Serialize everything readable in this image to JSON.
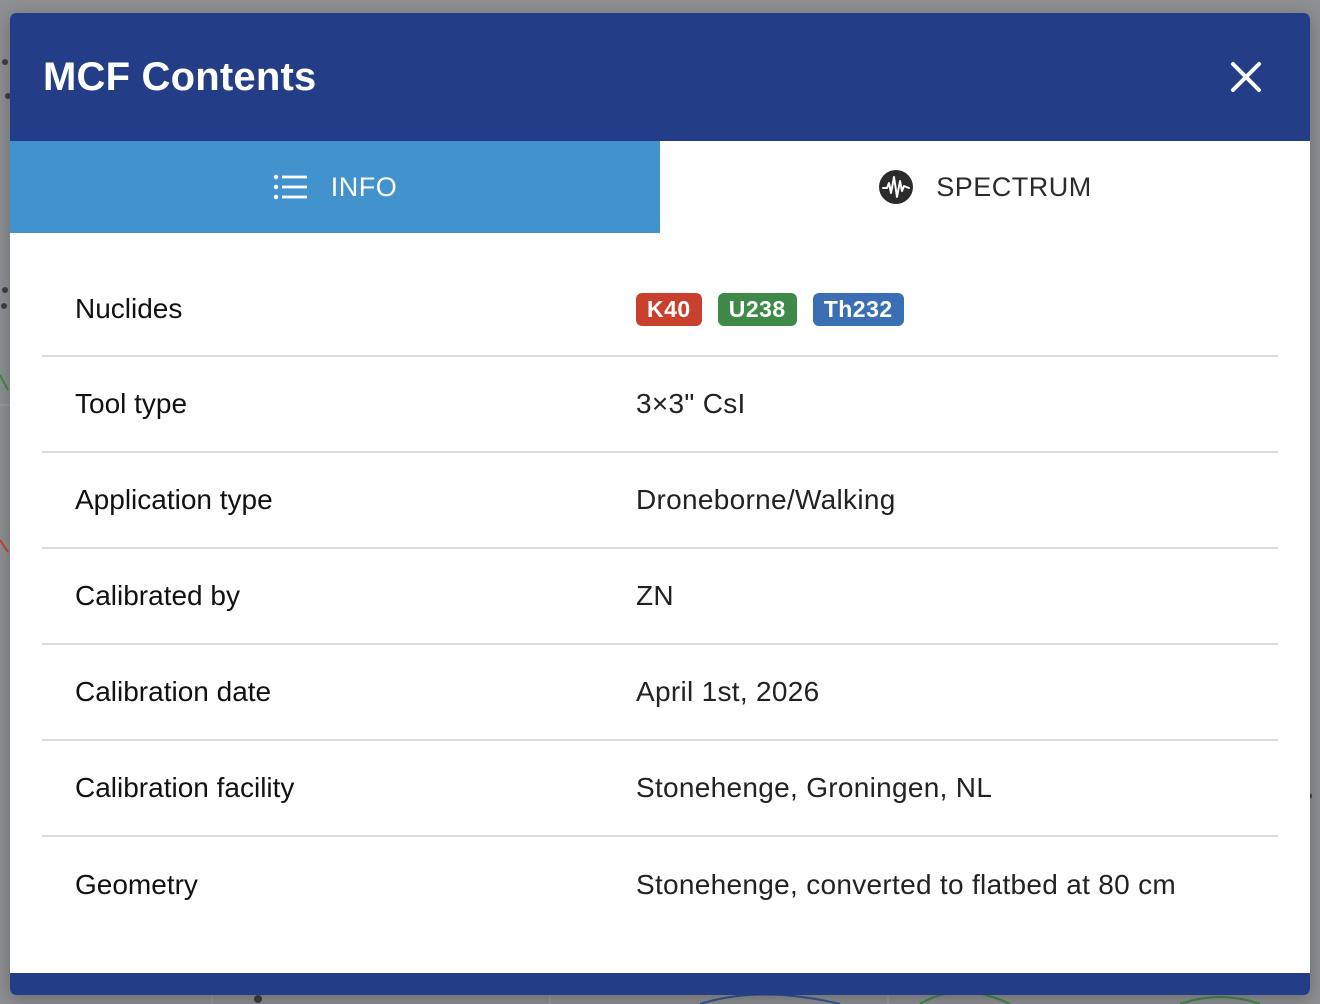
{
  "modal": {
    "title": "MCF Contents",
    "close_icon": "close-icon"
  },
  "tabs": [
    {
      "label": "INFO",
      "icon": "list-icon",
      "active": true
    },
    {
      "label": "SPECTRUM",
      "icon": "waveform-icon",
      "active": false
    }
  ],
  "info": {
    "nuclides": {
      "label": "Nuclides",
      "badges": [
        {
          "text": "K40",
          "color": "#c9402e"
        },
        {
          "text": "U238",
          "color": "#3f8a48"
        },
        {
          "text": "Th232",
          "color": "#3a6fb3"
        }
      ]
    },
    "rows": [
      {
        "label": "Tool type",
        "value": "3×3\" CsI"
      },
      {
        "label": "Application type",
        "value": "Droneborne/Walking"
      },
      {
        "label": "Calibrated by",
        "value": "ZN"
      },
      {
        "label": "Calibration date",
        "value": "April 1st, 2026"
      },
      {
        "label": "Calibration facility",
        "value": "Stonehenge, Groningen, NL"
      },
      {
        "label": "Geometry",
        "value": "Stonehenge, converted to flatbed at 80 cm"
      }
    ]
  },
  "colors": {
    "header": "#233d86",
    "active_tab": "#4192cd"
  }
}
